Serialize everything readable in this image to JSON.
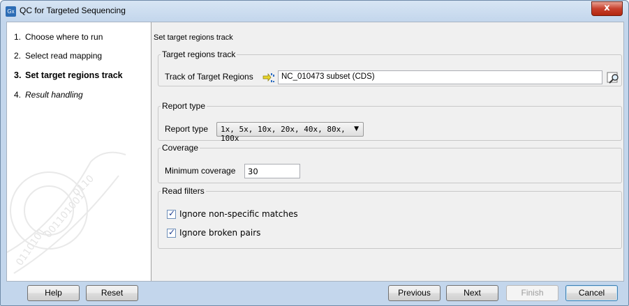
{
  "window": {
    "title": "QC for Targeted Sequencing",
    "app_icon_text": "Gx",
    "close_symbol": "x"
  },
  "sidebar": {
    "steps": [
      {
        "num": "1.",
        "label": "Choose where to run"
      },
      {
        "num": "2.",
        "label": "Select read mapping"
      },
      {
        "num": "3.",
        "label": "Set target regions track"
      },
      {
        "num": "4.",
        "label": "Result handling"
      }
    ]
  },
  "main": {
    "section_title": "Set target regions track",
    "target_group": {
      "legend": "Target regions track",
      "label": "Track of Target Regions",
      "value": "NC_010473 subset (CDS)",
      "track_icon": "track-icon",
      "browse_icon": "browse-icon"
    },
    "report_group": {
      "legend": "Report type",
      "label": "Report type",
      "selected": "1x, 5x, 10x, 20x, 40x, 80x, 100x"
    },
    "coverage_group": {
      "legend": "Coverage",
      "label": "Minimum coverage",
      "value": "30"
    },
    "filters_group": {
      "legend": "Read filters",
      "opt1": "Ignore non-specific matches",
      "opt1_checked": true,
      "opt2": "Ignore broken pairs",
      "opt2_checked": true
    }
  },
  "footer": {
    "help": "Help",
    "reset": "Reset",
    "previous": "Previous",
    "next": "Next",
    "finish": "Finish",
    "cancel": "Cancel"
  },
  "colors": {
    "title_bar": "#c3d6ec",
    "close_button": "#c7402d",
    "panel_bg": "#f0f0f0"
  }
}
